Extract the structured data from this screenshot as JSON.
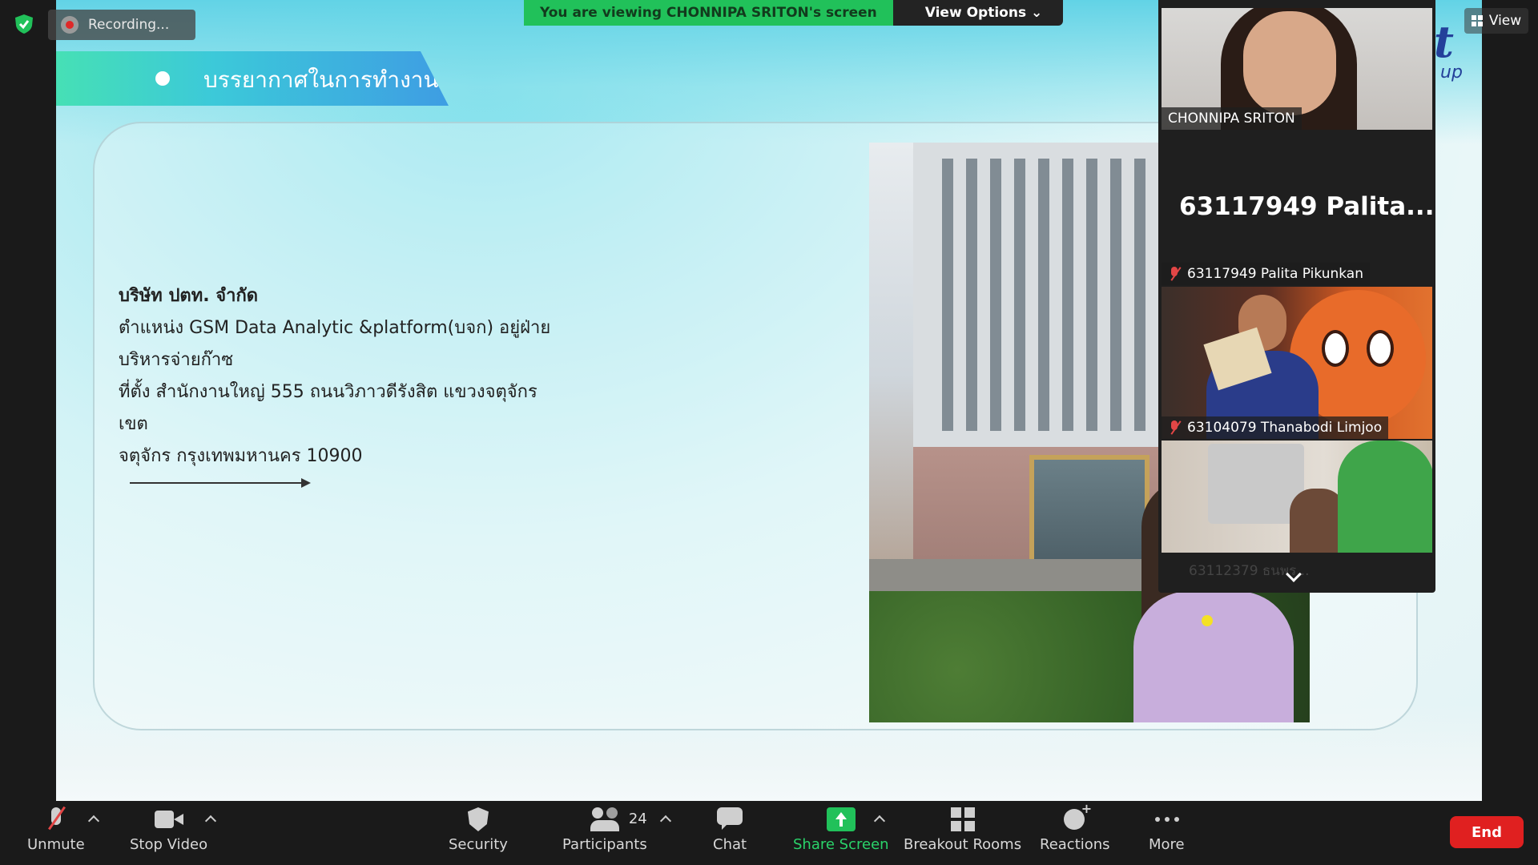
{
  "window": {
    "app": "Zoom Meeting"
  },
  "security_badge": {
    "icon": "shield-check-icon",
    "color": "#21c15a"
  },
  "recording": {
    "label": "Recording..."
  },
  "viewing_banner": {
    "text": "You are viewing CHONNIPA SRITON's screen",
    "options_label": "View Options",
    "options_chevron": "⌄"
  },
  "view_button": {
    "label": "View"
  },
  "slide": {
    "header": "บรรยากาศในการทำงาน",
    "company": "บริษัท ปตท. จำกัด",
    "position_prefix": "ตำแหน่ง ",
    "position_role": "GSM Data Analytic &platform(บจก)",
    "position_suffix": " อยู่ฝ่าย",
    "position_line2": "บริหารจ่ายก๊าซ",
    "location_line1": "ที่ตั้ง สำนักงานใหญ่ 555 ถนนวิภาวดีรังสิต แขวงจตุจักร เขต",
    "location_line2": "จตุจักร กรุงเทพมหานคร 10900",
    "logo_text": "t",
    "logo_sub": "up"
  },
  "gallery": {
    "tiles": [
      {
        "name": "CHONNIPA SRITON",
        "muted": false
      },
      {
        "name": "63117949 Palita Pikunkan",
        "display_name": "63117949  Palita...",
        "muted": true
      },
      {
        "name": "63104079 Thanabodi Limjoo",
        "muted": true
      },
      {
        "name": "63112379 ธนพร...",
        "muted": true
      }
    ]
  },
  "toolbar": {
    "unmute": "Unmute",
    "stop_video": "Stop Video",
    "security": "Security",
    "participants": "Participants",
    "participants_count": "24",
    "chat": "Chat",
    "share_screen": "Share Screen",
    "breakout_rooms": "Breakout Rooms",
    "reactions": "Reactions",
    "more": "More",
    "end": "End"
  },
  "colors": {
    "accent_green": "#21c15a",
    "end_red": "#e02020",
    "banner_green": "#21c15a"
  }
}
